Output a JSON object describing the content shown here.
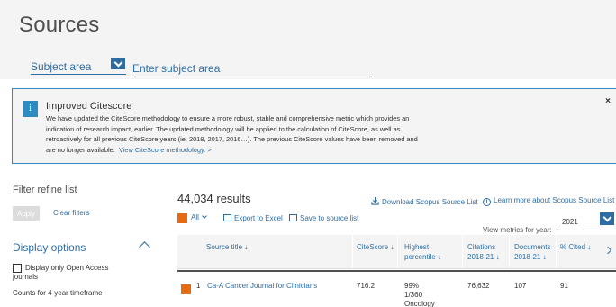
{
  "page": {
    "title": "Sources",
    "subject_area_label": "Subject area",
    "subject_input_placeholder": "Enter subject area"
  },
  "notice": {
    "title": "Improved Citescore",
    "body": "We have updated the CiteScore methodology to ensure a more robust, stable and comprehensive metric which provides an indication of research impact, earlier. The updated methodology will be applied to the calculation of CiteScore, as well as retroactively for all previous CiteScore years (ie. 2018, 2017, 2016…). The previous CiteScore values have been removed and are no longer available.",
    "link": "View CiteScore methodology. >",
    "close": "×"
  },
  "filters": {
    "title": "Filter refine list",
    "apply": "Apply",
    "clear": "Clear filters",
    "display_options": "Display options",
    "open_access_label_line1": "Display only Open Access",
    "open_access_label_line2": "journals",
    "counts_label": "Counts for 4-year timeframe"
  },
  "results": {
    "count": "44,034 results",
    "download": "Download Scopus Source List",
    "learn_more": "Learn more about Scopus Source List",
    "all_label": "All",
    "export": "Export to Excel",
    "save": "Save to source list",
    "view_metrics": "View metrics for year:",
    "year": "2021"
  },
  "table": {
    "headers": {
      "source_title": "Source title ↓",
      "citescore": "CiteScore ↓",
      "highest_percentile_l1": "Highest",
      "highest_percentile_l2": "percentile ↓",
      "citations_l1": "Citations",
      "citations_l2": "2018-21 ↓",
      "documents_l1": "Documents",
      "documents_l2": "2018-21 ↓",
      "cited": "% Cited ↓"
    },
    "rows": [
      {
        "rank": "1",
        "title": "Ca-A Cancer Journal for Clinicians",
        "citescore": "716.2",
        "percentile_l1": "99%",
        "percentile_l2": "1/360",
        "percentile_l3": "Oncology",
        "citations": "76,632",
        "documents": "107",
        "cited": "91"
      }
    ]
  },
  "colors": {
    "link": "#2e6da4",
    "accent_orange": "#e86a10",
    "notice_border": "#2e8bc0"
  }
}
